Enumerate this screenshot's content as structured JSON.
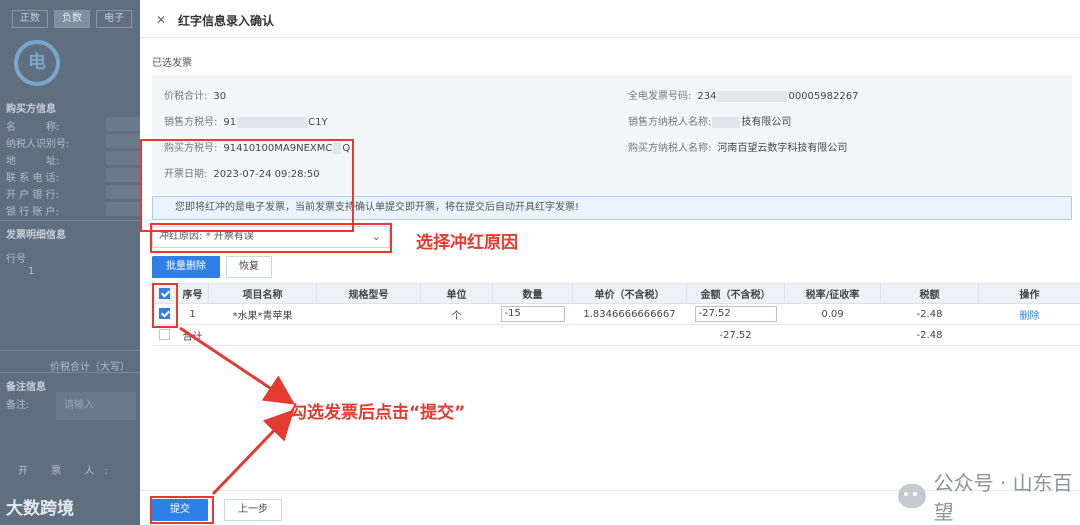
{
  "background_page": {
    "tabs": [
      "正数",
      "负数",
      "电子"
    ],
    "logo_text": "电",
    "buyer_section_title": "购买方信息",
    "buyer_fields": [
      "名　　　称:",
      "纳税人识别号:",
      "地　　　址:",
      "联 系 电 话:",
      "开 户 银 行:",
      "银 行 账 户:"
    ],
    "detail_section_title": "发票明细信息",
    "row_label": "行号",
    "row_value": "1",
    "total_label": "价税合计（大写）",
    "memo_section_title": "备注信息",
    "memo_label": "备注:",
    "memo_placeholder": "请输入",
    "opener_label": "开 票 人:",
    "watermark": "大数跨境"
  },
  "dialog": {
    "title": "红字信息录入确认",
    "close_icon": "close-icon",
    "selected_section_label": "已选发票",
    "info": {
      "total_label": "价税合计:",
      "total_value": "30",
      "invoice_no_label": "全电发票号码:",
      "invoice_no_prefix": "234",
      "invoice_no_suffix": "00005982267",
      "seller_tax_label": "销售方税号:",
      "seller_tax_prefix": "91",
      "seller_tax_suffix": "C1Y",
      "seller_name_label": "销售方纳税人名称:",
      "seller_name_suffix": "技有限公司",
      "buyer_tax_label": "购买方税号:",
      "buyer_tax_value": "91410100MA9NEXMC",
      "buyer_tax_suffix": "Q",
      "buyer_name_label": "购买方纳税人名称:",
      "buyer_name_value": "河南百望云数字科技有限公司",
      "date_label": "开票日期:",
      "date_value": "2023-07-24 09:28:50"
    },
    "notice": "您即将红冲的是电子发票，当前发票支持确认单提交即开票，将在提交后自动开具红字发票!",
    "reason": {
      "label": "冲红原因:",
      "required_mark": "*",
      "selected": "开票有误"
    },
    "buttons": {
      "batch_delete": "批量删除",
      "restore": "恢复",
      "submit": "提交",
      "previous": "上一步"
    },
    "table": {
      "headers": [
        "序号",
        "项目名称",
        "规格型号",
        "单位",
        "数量",
        "单价（不含税）",
        "金额（不含税）",
        "税率/征收率",
        "税额",
        "操作"
      ],
      "row": {
        "index": "1",
        "item": "*水果*青苹果",
        "spec": "",
        "unit": "个",
        "quantity": "-15",
        "unit_price": "1.8346666666667",
        "amount": "-27.52",
        "tax_rate": "0.09",
        "tax": "-2.48",
        "action": "删除"
      },
      "total_row": {
        "label": "合计",
        "amount": "-27.52",
        "tax": "-2.48"
      }
    }
  },
  "annotations": {
    "reason_hint": "选择冲红原因",
    "submit_hint": "勾选发票后点击“提交”",
    "accent_color": "#e53a2f"
  },
  "watermark_right": "公众号 · 山东百望"
}
